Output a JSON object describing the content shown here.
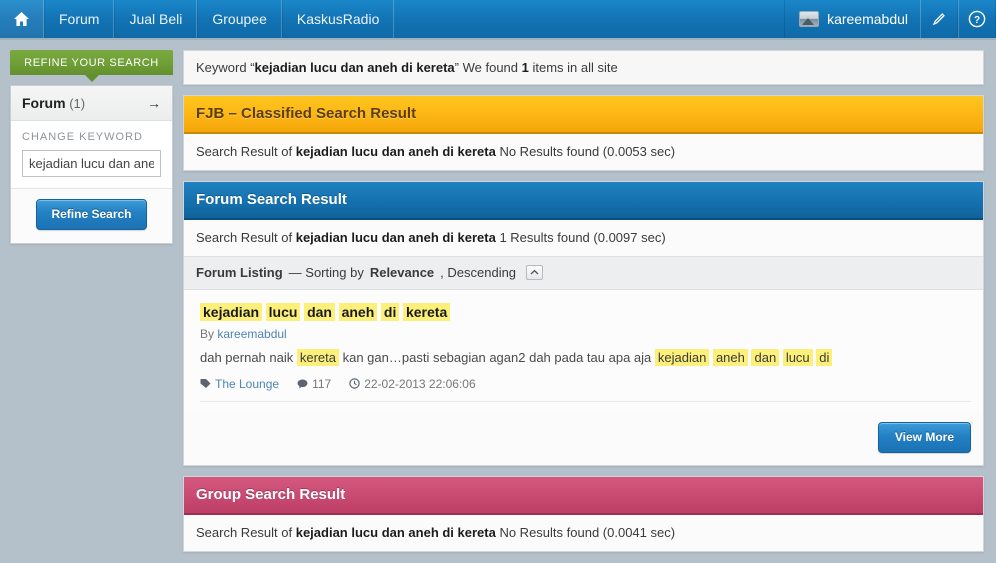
{
  "colors": {
    "nav_blue": "#1273b4",
    "green_tab": "#6f9f36",
    "fjb_amber": "#fcb514",
    "forum_blue": "#1571ae",
    "group_pink": "#c94a71",
    "highlight_yellow": "#fcf07a",
    "page_bg": "#b4c0ca",
    "link_blue": "#4c85b5"
  },
  "topbar": {
    "home_icon": "home-icon",
    "items": [
      {
        "label": "Forum"
      },
      {
        "label": "Jual Beli"
      },
      {
        "label": "Groupee"
      },
      {
        "label": "KaskusRadio"
      }
    ],
    "user": {
      "avatar_icon": "avatar-icon",
      "name": "kareemabdul"
    },
    "edit_icon": "pencil-icon",
    "help_icon": "question-mark-icon"
  },
  "sidebar": {
    "refine_tab_label": "REFINE YOUR SEARCH",
    "facet": {
      "name": "Forum",
      "count": "(1)",
      "arrow_icon": "arrow-right-icon"
    },
    "change_keyword_label": "CHANGE KEYWORD",
    "keyword_input_value": "kejadian lucu dan aneh di kereta",
    "keyword_input_placeholder": "Enter keyword",
    "refine_button_label": "Refine Search"
  },
  "keyword_bar": {
    "prefix": "Keyword “",
    "keyword": "kejadian lucu dan aneh di kereta",
    "middle": "” We found ",
    "count": "1",
    "suffix": " items in all site"
  },
  "fjb": {
    "title": "FJB – Classified Search Result",
    "result_prefix": "Search Result of ",
    "result_keyword": "kejadian lucu dan aneh di kereta",
    "result_suffix": " No Results found (0.0053 sec)"
  },
  "forum": {
    "title": "Forum Search Result",
    "result_prefix": "Search Result of ",
    "result_keyword": "kejadian lucu dan aneh di kereta",
    "result_suffix": " 1 Results found (0.0097 sec)",
    "sort": {
      "listing_label": "Forum Listing",
      "dash": "— Sorting by ",
      "sort_field": "Relevance",
      "sort_direction": ", Descending",
      "toggle_icon": "chevron-up-icon"
    },
    "hit": {
      "title_tokens": [
        {
          "text": "kejadian",
          "highlight": true
        },
        {
          "text": "lucu",
          "highlight": true
        },
        {
          "text": "dan",
          "highlight": true
        },
        {
          "text": "aneh",
          "highlight": true
        },
        {
          "text": "di",
          "highlight": true
        },
        {
          "text": "kereta",
          "highlight": true
        }
      ],
      "by_label": "By ",
      "author": "kareemabdul",
      "snippet_tokens": [
        {
          "text": "dah pernah naik ",
          "highlight": false
        },
        {
          "text": "kereta",
          "highlight": true
        },
        {
          "text": " kan gan…pasti sebagian agan2 dah pada tau apa aja ",
          "highlight": false
        },
        {
          "text": "kejadian",
          "highlight": true
        },
        {
          "text": " ",
          "highlight": false
        },
        {
          "text": "aneh",
          "highlight": true
        },
        {
          "text": " ",
          "highlight": false
        },
        {
          "text": "dan",
          "highlight": true
        },
        {
          "text": " ",
          "highlight": false
        },
        {
          "text": "lucu",
          "highlight": true
        },
        {
          "text": " ",
          "highlight": false
        },
        {
          "text": "di",
          "highlight": true
        }
      ],
      "meta": {
        "tag_icon": "tag-icon",
        "forum_name": "The Lounge",
        "comment_icon": "comment-bubble-icon",
        "comment_count": "117",
        "clock_icon": "clock-icon",
        "timestamp": "22-02-2013 22:06:06"
      }
    },
    "view_more_label": "View More"
  },
  "group": {
    "title": "Group Search Result",
    "result_prefix": "Search Result of ",
    "result_keyword": "kejadian lucu dan aneh di kereta",
    "result_suffix": " No Results found (0.0041 sec)"
  }
}
